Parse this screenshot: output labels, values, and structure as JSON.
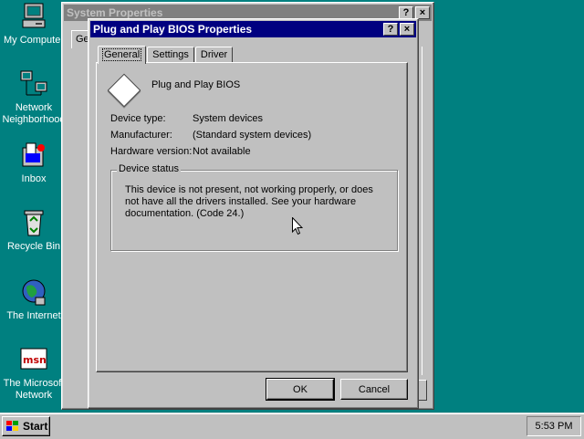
{
  "desktop": {
    "icons": [
      {
        "label": "My Computer",
        "icon": "computer-icon"
      },
      {
        "label": "Network Neighborhood",
        "label_line1": "Network",
        "label_line2": "Neighborhood",
        "icon": "network-icon"
      },
      {
        "label": "Inbox",
        "icon": "inbox-icon"
      },
      {
        "label": "Recycle Bin",
        "icon": "recycle-bin-icon"
      },
      {
        "label": "The Internet",
        "icon": "internet-icon"
      },
      {
        "label": "The Microsoft Network",
        "label_line1": "The Microsoft",
        "label_line2": "Network",
        "icon": "msn-icon"
      }
    ]
  },
  "system_window": {
    "title": "System Properties",
    "help_btn": "?",
    "close_btn": "×",
    "tab_stub": "Ge"
  },
  "bios_dialog": {
    "title": "Plug and Play BIOS Properties",
    "help_btn": "?",
    "close_btn": "×",
    "tabs": [
      {
        "label": "General",
        "selected": true
      },
      {
        "label": "Settings",
        "selected": false
      },
      {
        "label": "Driver",
        "selected": false
      }
    ],
    "device_name": "Plug and Play BIOS",
    "properties": [
      {
        "label": "Device type:",
        "value": "System devices"
      },
      {
        "label": "Manufacturer:",
        "value": "(Standard system devices)"
      },
      {
        "label": "Hardware version:",
        "value": "Not available"
      }
    ],
    "status_group_label": "Device status",
    "status_text": "This device is not present, not working properly, or does not have all the drivers installed. See your hardware documentation.  (Code 24.)",
    "ok_label": "OK",
    "cancel_label": "Cancel"
  },
  "taskbar": {
    "start_label": "Start",
    "clock": "5:53 PM"
  },
  "colors": {
    "desktop": "#008080",
    "active_title": "#000080",
    "inactive_title": "#808080",
    "face": "#c0c0c0"
  }
}
